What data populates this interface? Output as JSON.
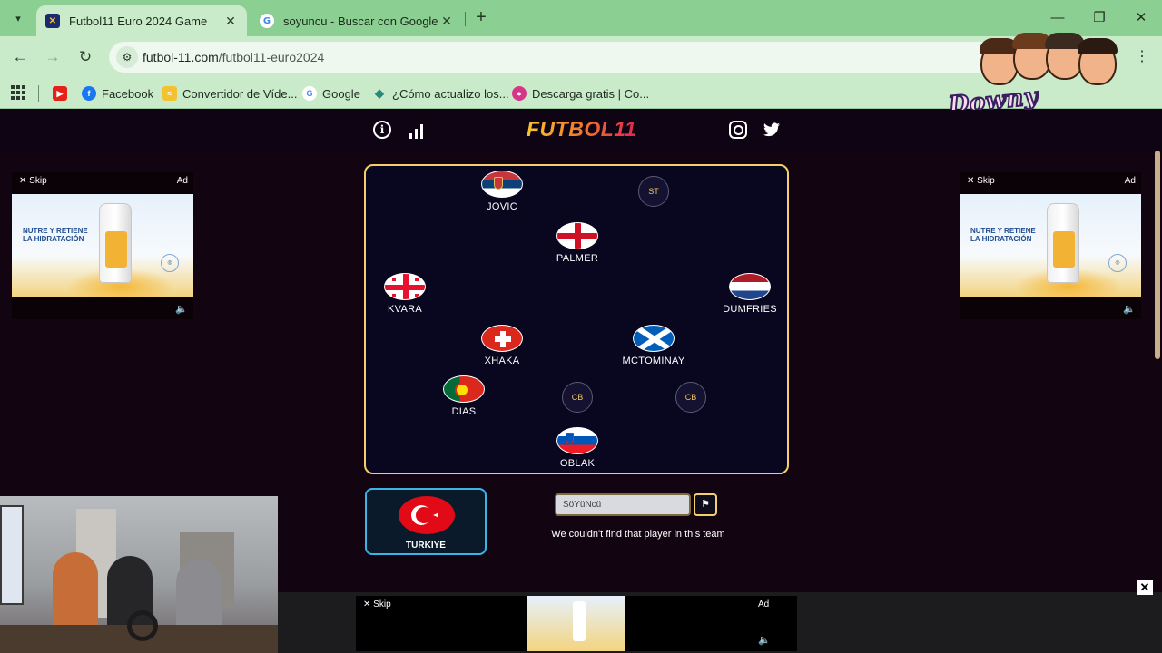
{
  "browser": {
    "tabs": [
      {
        "title": "Futbol11 Euro 2024 Game",
        "active": true
      },
      {
        "title": "soyuncu - Buscar con Google",
        "active": false
      }
    ],
    "url_domain": "futbol-11.com",
    "url_path": "/futbol11-euro2024",
    "bookmarks": [
      {
        "label": "Facebook",
        "icon": "facebook-icon"
      },
      {
        "label": "Convertidor de Víde...",
        "icon": "converter-icon"
      },
      {
        "label": "Google",
        "icon": "google-icon"
      },
      {
        "label": "¿Cómo actualizo los...",
        "icon": "drop-icon"
      },
      {
        "label": "Descarga gratis | Co...",
        "icon": "download-icon"
      }
    ]
  },
  "overlay": {
    "brand": "Downy Concentrao"
  },
  "site": {
    "logo": "FUTBOL11",
    "ads": {
      "skip": "Skip",
      "ad": "Ad",
      "line1": "NUTRE Y RETIENE",
      "line2": "LA HIDRATACIÓN"
    },
    "pitch": {
      "players": [
        {
          "name": "JOVIC",
          "flag": "serbia"
        },
        {
          "name": "PALMER",
          "flag": "england"
        },
        {
          "name": "KVARA",
          "flag": "georgia"
        },
        {
          "name": "DUMFRIES",
          "flag": "netherlands"
        },
        {
          "name": "XHAKA",
          "flag": "switzerland"
        },
        {
          "name": "MCTOMINAY",
          "flag": "scotland"
        },
        {
          "name": "DIAS",
          "flag": "portugal"
        },
        {
          "name": "OBLAK",
          "flag": "slovenia"
        }
      ],
      "slots": [
        "ST",
        "CB",
        "CB"
      ]
    },
    "team": {
      "name": "TURKIYE"
    },
    "guess": {
      "value": "SöYüNcü"
    },
    "message": "We couldn't find that player in this team",
    "colors": {
      "accent_gold": "#f5cf6c",
      "accent_blue": "#3db4e6",
      "header_red": "#8a1730"
    }
  }
}
